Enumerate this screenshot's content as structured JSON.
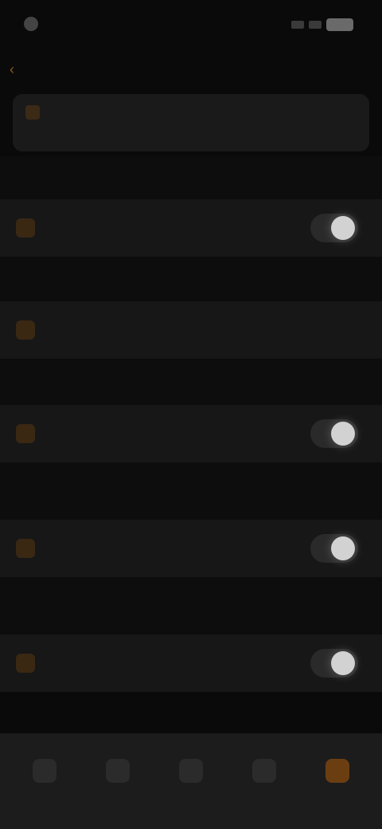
{
  "status_bar": {
    "time": "",
    "battery_level": ""
  },
  "header": {
    "back_label": "",
    "title": ""
  },
  "info_card": {
    "title": "",
    "subtitle": ""
  },
  "settings": [
    {
      "label": "",
      "control": "toggle",
      "on": true
    },
    {
      "label": "",
      "control": "value",
      "value": ""
    },
    {
      "label": "",
      "control": "toggle",
      "on": true
    },
    {
      "label": "",
      "control": "toggle",
      "on": true
    },
    {
      "label": "",
      "control": "toggle",
      "on": true
    }
  ],
  "bottom_nav": [
    {
      "label": "",
      "active": false
    },
    {
      "label": "",
      "active": false
    },
    {
      "label": "",
      "active": false
    },
    {
      "label": "",
      "active": false
    },
    {
      "label": "",
      "active": true
    }
  ],
  "colors": {
    "accent": "#8a5a20",
    "background": "#0a0a0a",
    "card": "#1a1a1a",
    "toggle_knob": "#d2d2d2"
  }
}
